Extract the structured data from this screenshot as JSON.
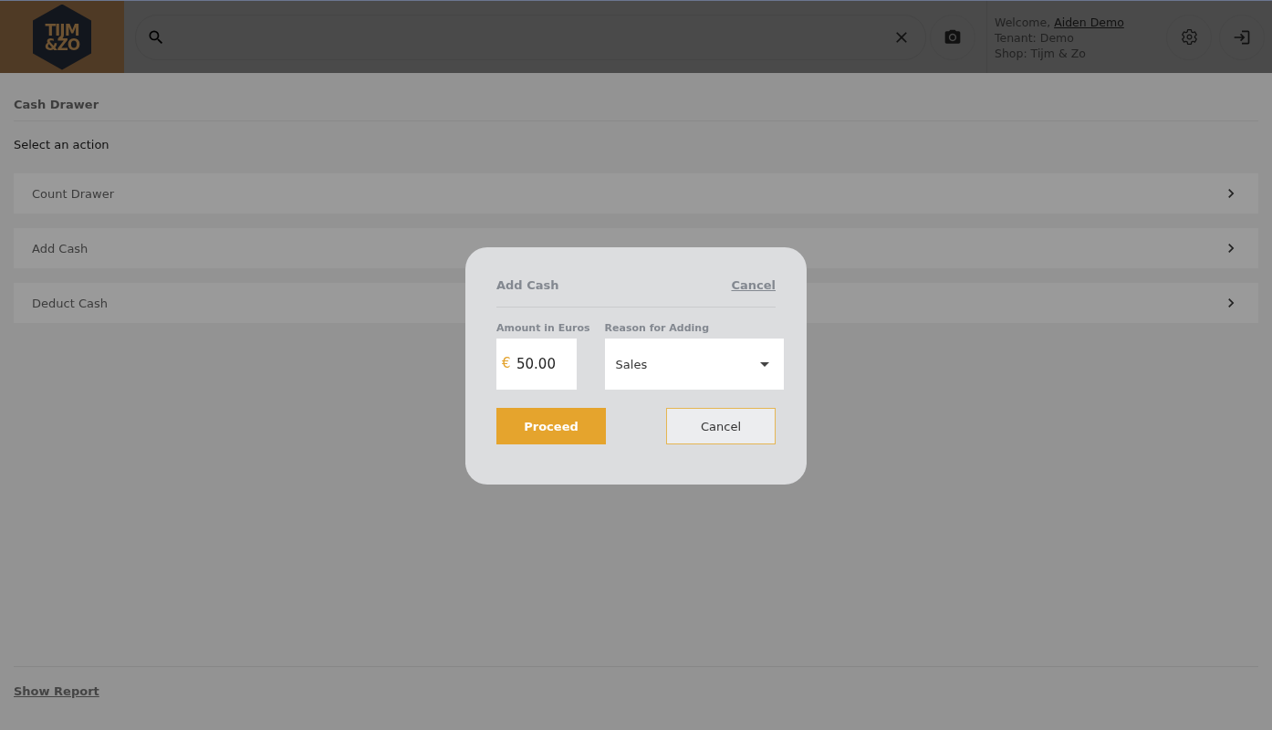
{
  "header": {
    "logo_lines": [
      "TIJM",
      "&ZO"
    ],
    "welcome_prefix": "Welcome,",
    "user_name": "Aiden Demo",
    "tenant": "Tenant: Demo",
    "shop": "Shop: Tijm & Zo"
  },
  "page": {
    "title": "Cash Drawer",
    "subtitle": "Select an action",
    "actions": [
      {
        "label": "Count Drawer"
      },
      {
        "label": "Add Cash"
      },
      {
        "label": "Deduct Cash"
      }
    ],
    "footer_link": "Show Report"
  },
  "dialog": {
    "title": "Add Cash",
    "close_link": "Cancel",
    "amount_label": "Amount in Euros",
    "currency": "€",
    "amount": "50.00",
    "reason_label": "Reason for Adding",
    "reason": "Sales",
    "primary_button": "Proceed",
    "secondary_button": "Cancel"
  }
}
